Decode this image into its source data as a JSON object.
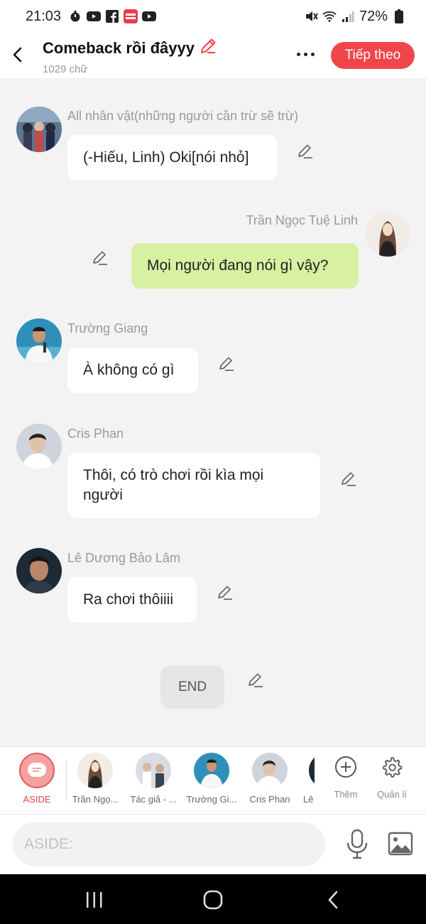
{
  "status_bar": {
    "time": "21:03",
    "battery": "72%",
    "left_icons": [
      "timer-icon",
      "youtube-icon",
      "facebook-icon",
      "mangatoon-icon",
      "youtube-icon"
    ],
    "right_icons": [
      "mute-icon",
      "wifi-icon",
      "signal-icon",
      "battery-icon"
    ]
  },
  "header": {
    "title": "Comeback rồi đâyyy",
    "word_count": "1029 chữ",
    "next_label": "Tiếp theo"
  },
  "messages": [
    {
      "side": "left",
      "name": "All nhân vật(những người cần trừ sẽ trừ)",
      "text": "(-Hiếu, Linh) Oki[nói nhỏ]"
    },
    {
      "side": "right",
      "name": "Trần Ngọc Tuệ Linh",
      "text": "Mọi người đang nói gì vậy?"
    },
    {
      "side": "left",
      "name": "Trường Giang",
      "text": "À không có gì"
    },
    {
      "side": "left",
      "name": "Cris Phan",
      "text": "Thôi, có trò chơi rồi kìa mọi người"
    },
    {
      "side": "left",
      "name": "Lê Dương Bảo Lâm",
      "text": "Ra chơi thôiiii"
    }
  ],
  "end_label": "END",
  "characters": [
    {
      "label": "ASIDE"
    },
    {
      "label": "Trần Ngọ..."
    },
    {
      "label": "Tác giả - ..."
    },
    {
      "label": "Trường Gi..."
    },
    {
      "label": "Cris Phan"
    },
    {
      "label": "Lê"
    }
  ],
  "tools": {
    "add_label": "Thêm",
    "manage_label": "Quản lí"
  },
  "input": {
    "placeholder": "ASIDE:"
  },
  "colors": {
    "accent": "#f0464a",
    "my_bubble": "#d8f0a2",
    "other_bubble": "#ffffff",
    "background": "#f3f3f3"
  }
}
